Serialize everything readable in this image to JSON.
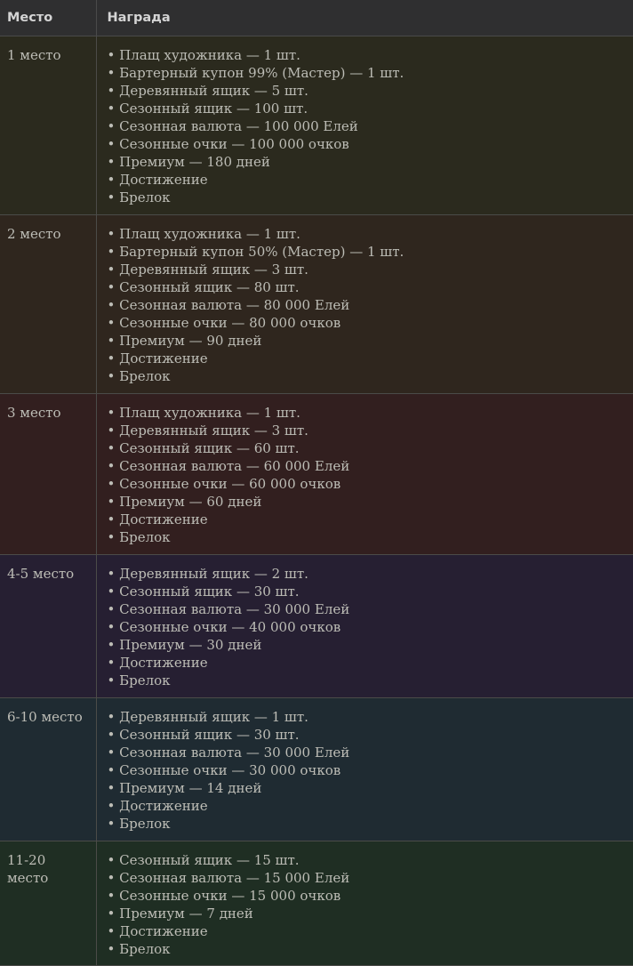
{
  "table": {
    "headers": {
      "place": "Место",
      "reward": "Награда"
    },
    "rows": [
      {
        "place": "1 место",
        "bg": "#2b2a1e",
        "rewards": [
          "Плащ художника — 1 шт.",
          "Бартерный купон 99% (Мастер) — 1 шт.",
          "Деревянный ящик — 5 шт.",
          "Сезонный ящик — 100 шт.",
          "Сезонная валюта — 100 000 Елей",
          "Сезонные очки — 100 000 очков",
          "Премиум — 180 дней",
          "Достижение",
          "Брелок"
        ]
      },
      {
        "place": "2 место",
        "bg": "#2f261e",
        "rewards": [
          "Плащ художника — 1 шт.",
          "Бартерный купон 50% (Мастер) — 1 шт.",
          "Деревянный ящик — 3 шт.",
          "Сезонный ящик — 80 шт.",
          "Сезонная валюта — 80 000 Елей",
          "Сезонные очки — 80 000 очков",
          "Премиум — 90 дней",
          "Достижение",
          "Брелок"
        ]
      },
      {
        "place": "3 место",
        "bg": "#321f1f",
        "rewards": [
          "Плащ художника — 1 шт.",
          "Деревянный ящик — 3 шт.",
          "Сезонный ящик — 60 шт.",
          "Сезонная валюта — 60 000 Елей",
          "Сезонные очки — 60 000 очков",
          "Премиум — 60 дней",
          "Достижение",
          "Брелок"
        ]
      },
      {
        "place": "4-5 место",
        "bg": "#261f32",
        "rewards": [
          "Деревянный ящик — 2 шт.",
          "Сезонный ящик — 30 шт.",
          "Сезонная валюта — 30 000 Елей",
          "Сезонные очки — 40 000 очков",
          "Премиум — 30 дней",
          "Достижение",
          "Брелок"
        ]
      },
      {
        "place": "6-10 место",
        "bg": "#1f2b32",
        "rewards": [
          "Деревянный ящик — 1 шт.",
          "Сезонный ящик — 30 шт.",
          "Сезонная валюта — 30 000 Елей",
          "Сезонные очки — 30 000 очков",
          "Премиум — 14 дней",
          "Достижение",
          "Брелок"
        ]
      },
      {
        "place": "11-20 место",
        "bg": "#1f2e23",
        "rewards": [
          "Сезонный ящик — 15 шт.",
          "Сезонная валюта — 15 000 Елей",
          "Сезонные очки — 15 000 очков",
          "Премиум — 7 дней",
          "Достижение",
          "Брелок"
        ]
      }
    ]
  }
}
